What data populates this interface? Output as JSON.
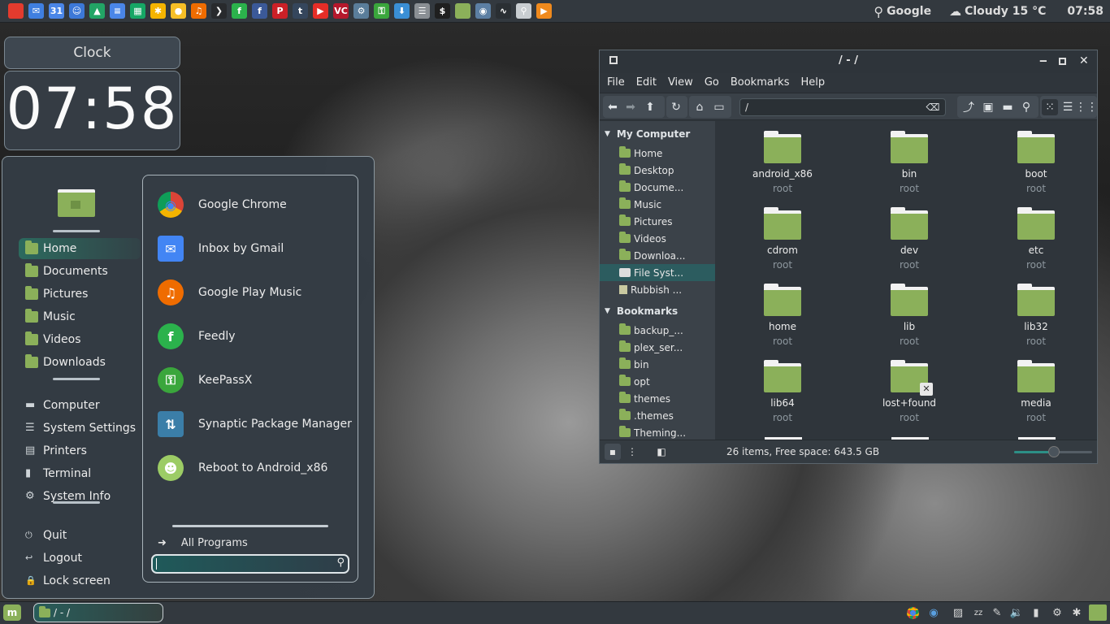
{
  "top_panel": {
    "launchers": [
      {
        "name": "chrome-icon",
        "glyph": "",
        "color": "#e33b2e"
      },
      {
        "name": "gmail-inbox-icon",
        "glyph": "✉",
        "color": "#3f7fe0"
      },
      {
        "name": "calendar-icon",
        "glyph": "31",
        "color": "#4a86e8"
      },
      {
        "name": "contacts-icon",
        "glyph": "☺",
        "color": "#3c78d8"
      },
      {
        "name": "drive-icon",
        "glyph": "▲",
        "color": "#22a565"
      },
      {
        "name": "docs-icon",
        "glyph": "≡",
        "color": "#4a86e8"
      },
      {
        "name": "sheets-icon",
        "glyph": "▦",
        "color": "#16a765"
      },
      {
        "name": "photos-icon",
        "glyph": "✱",
        "color": "#f4b400"
      },
      {
        "name": "keep-icon",
        "glyph": "●",
        "color": "#f6bf26"
      },
      {
        "name": "play-music-icon",
        "glyph": "♫",
        "color": "#ef6c00"
      },
      {
        "name": "plex-icon",
        "glyph": "❯",
        "color": "#282a2d"
      },
      {
        "name": "feedly-icon",
        "glyph": "f",
        "color": "#2bb24c"
      },
      {
        "name": "facebook-icon",
        "glyph": "f",
        "color": "#3b5998"
      },
      {
        "name": "pinterest-icon",
        "glyph": "P",
        "color": "#cb2027"
      },
      {
        "name": "tumblr-icon",
        "glyph": "t",
        "color": "#35465c"
      },
      {
        "name": "youtube-icon",
        "glyph": "▶",
        "color": "#e52d27"
      },
      {
        "name": "vc-icon",
        "glyph": "VC",
        "color": "#b5182c"
      },
      {
        "name": "network-icon",
        "glyph": "⚙",
        "color": "#5a7d9a"
      },
      {
        "name": "keepassx-icon",
        "glyph": "⚿",
        "color": "#3aa63c"
      },
      {
        "name": "download-icon",
        "glyph": "⬇",
        "color": "#3a8fd6"
      },
      {
        "name": "settings-icon",
        "glyph": "☰",
        "color": "#8a8f94"
      },
      {
        "name": "terminal-icon",
        "glyph": "$",
        "color": "#1f1f1f"
      },
      {
        "name": "files-icon",
        "glyph": "",
        "color": "#8bb05a"
      },
      {
        "name": "camera-icon",
        "glyph": "◉",
        "color": "#5c7fa3"
      },
      {
        "name": "system-monitor-icon",
        "glyph": "∿",
        "color": "#2a2f33"
      },
      {
        "name": "search-app-icon",
        "glyph": "⚲",
        "color": "#c9ced2"
      },
      {
        "name": "vlc-play-icon",
        "glyph": "▶",
        "color": "#f08a1d"
      }
    ],
    "search_label": "Google",
    "weather": "Cloudy 15 °C",
    "time": "07:58"
  },
  "clock": {
    "title": "Clock",
    "time": "07:58"
  },
  "menu": {
    "places": [
      "Home",
      "Documents",
      "Pictures",
      "Music",
      "Videos",
      "Downloads"
    ],
    "system": [
      "Computer",
      "System Settings",
      "Printers",
      "Terminal",
      "System Info"
    ],
    "session": [
      "Quit",
      "Logout",
      "Lock screen"
    ],
    "favorites": [
      {
        "label": "Google Chrome",
        "color": "#ffffff"
      },
      {
        "label": "Inbox by Gmail",
        "color": "#4285f4"
      },
      {
        "label": "Google Play Music",
        "color": "#ef6c00"
      },
      {
        "label": "Feedly",
        "color": "#2bb24c"
      },
      {
        "label": "KeePassX",
        "color": "#3aa63c"
      },
      {
        "label": "Synaptic Package Manager",
        "color": "#3b7ea8"
      },
      {
        "label": "Reboot to Android_x86",
        "color": "#9ccc65"
      }
    ],
    "all_programs": "All Programs"
  },
  "fm": {
    "title": "/ - /",
    "menus": [
      "File",
      "Edit",
      "View",
      "Go",
      "Bookmarks",
      "Help"
    ],
    "path": "/",
    "sidebar": {
      "my_computer": "My Computer",
      "computer_items": [
        "Home",
        "Desktop",
        "Docume...",
        "Music",
        "Pictures",
        "Videos",
        "Downloa...",
        "File Syst...",
        "Rubbish ..."
      ],
      "bookmarks": "Bookmarks",
      "bookmark_items": [
        "backup_...",
        "plex_ser...",
        "bin",
        "opt",
        "themes",
        ".themes",
        "Theming..."
      ]
    },
    "items": [
      {
        "name": "android_x86",
        "owner": "root"
      },
      {
        "name": "bin",
        "owner": "root"
      },
      {
        "name": "boot",
        "owner": "root"
      },
      {
        "name": "cdrom",
        "owner": "root"
      },
      {
        "name": "dev",
        "owner": "root"
      },
      {
        "name": "etc",
        "owner": "root"
      },
      {
        "name": "home",
        "owner": "root"
      },
      {
        "name": "lib",
        "owner": "root"
      },
      {
        "name": "lib32",
        "owner": "root"
      },
      {
        "name": "lib64",
        "owner": "root"
      },
      {
        "name": "lost+found",
        "owner": "root"
      },
      {
        "name": "media",
        "owner": "root"
      }
    ],
    "status": "26 items, Free space: 643.5 GB"
  },
  "bottom_panel": {
    "task_label": "/ - /"
  }
}
